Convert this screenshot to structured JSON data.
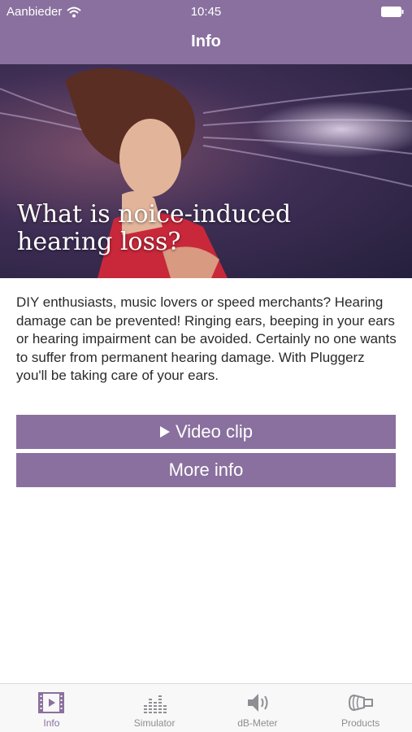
{
  "status_bar": {
    "carrier": "Aanbieder",
    "time": "10:45"
  },
  "nav": {
    "title": "Info"
  },
  "hero": {
    "title": "What is noice-induced hearing loss?"
  },
  "content": {
    "body": "DIY enthusiasts, music lovers or speed merchants? Hearing damage can be prevented! Ringing ears, beeping in your ears or hearing impairment can be avoided. Certainly no one wants to suffer from permanent hearing damage. With Pluggerz you'll be taking care of your ears."
  },
  "buttons": {
    "video_label": "Video clip",
    "more_label": "More info"
  },
  "tabs": [
    {
      "label": "Info",
      "icon": "film-icon",
      "active": true
    },
    {
      "label": "Simulator",
      "icon": "equalizer-icon",
      "active": false
    },
    {
      "label": "dB-Meter",
      "icon": "speaker-icon",
      "active": false
    },
    {
      "label": "Products",
      "icon": "earplug-icon",
      "active": false
    }
  ],
  "colors": {
    "accent": "#8a709e",
    "tab_inactive": "#8e8e93",
    "text": "#2a2a2a"
  }
}
